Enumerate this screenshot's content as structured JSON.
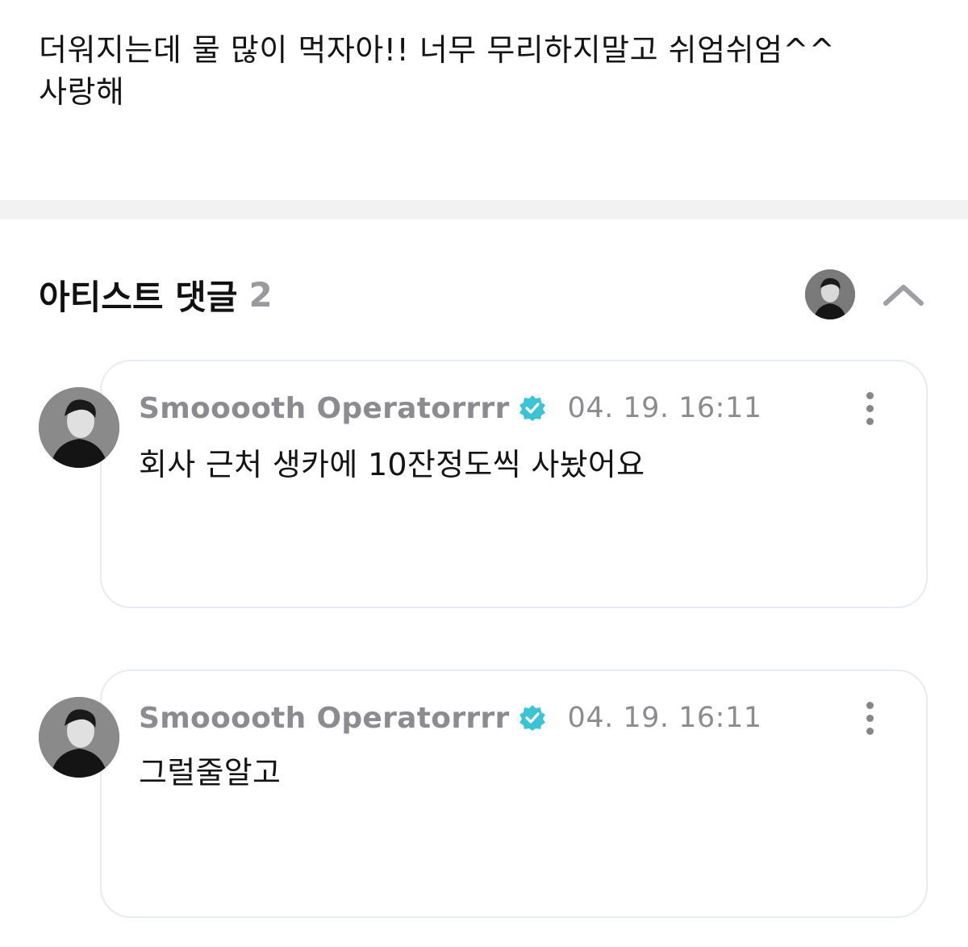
{
  "post": {
    "body": "더워지는데 물 많이 먹자아!! 너무 무리하지말고 쉬엄쉬엄^^\n사랑해"
  },
  "artist_comments": {
    "title": "아티스트 댓글",
    "count": "2",
    "icons": {
      "collapse": "chevron-up-icon",
      "more": "more-vertical-icon",
      "verified": "verified-badge-icon"
    },
    "colors": {
      "verified_badge": "#3cc4d6",
      "meta_text": "#8c8c90",
      "card_border": "#e8ebf0"
    },
    "items": [
      {
        "author": "Smooooth Operatorrrr",
        "timestamp": "04. 19. 16:11",
        "text": "회사 근처 생카에 10잔정도씩 사놨어요"
      },
      {
        "author": "Smooooth Operatorrrr",
        "timestamp": "04. 19. 16:11",
        "text": "그럴줄알고"
      }
    ]
  }
}
